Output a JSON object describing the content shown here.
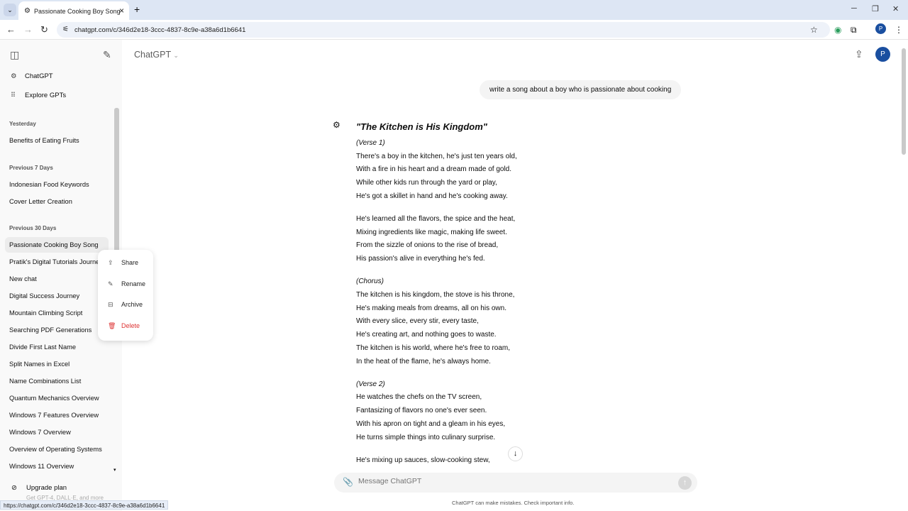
{
  "browser": {
    "tab_title": "Passionate Cooking Boy Song",
    "url": "chatgpt.com/c/346d2e18-3ccc-4837-8c9e-a38a6d1b6641",
    "profile": "P",
    "status_url": "https://chatgpt.com/c/346d2e18-3ccc-4837-8c9e-a38a6d1b6641"
  },
  "sidebar": {
    "top": [
      {
        "label": "ChatGPT",
        "icon": "openai-logo-icon"
      },
      {
        "label": "Explore GPTs",
        "icon": "grid-icon"
      }
    ],
    "groups": [
      {
        "heading": "Yesterday",
        "items": [
          "Benefits of Eating Fruits"
        ]
      },
      {
        "heading": "Previous 7 Days",
        "items": [
          "Indonesian Food Keywords",
          "Cover Letter Creation"
        ]
      },
      {
        "heading": "Previous 30 Days",
        "items": [
          "Passionate Cooking Boy Song",
          "Pratik's Digital Tutorials Journey",
          "New chat",
          "Digital Success Journey",
          "Mountain Climbing Script",
          "Searching PDF Generations",
          "Divide First Last Name",
          "Split Names in Excel",
          "Name Combinations List",
          "Quantum Mechanics Overview",
          "Windows 7 Features Overview",
          "Windows 7 Overview",
          "Overview of Operating Systems",
          "Windows 11 Overview"
        ]
      }
    ],
    "upgrade": {
      "label": "Upgrade plan",
      "sub": "Get GPT-4, DALL·E, and more"
    }
  },
  "context_menu": [
    "Share",
    "Rename",
    "Archive",
    "Delete"
  ],
  "header": {
    "model": "ChatGPT",
    "avatar": "P"
  },
  "chat": {
    "user_message": "write a song about a boy who is passionate about cooking",
    "title": "\"The Kitchen is His Kingdom\"",
    "stanzas": [
      {
        "label": "(Verse 1)",
        "lines": [
          "There's a boy in the kitchen, he's just ten years old,",
          "With a fire in his heart and a dream made of gold.",
          "While other kids run through the yard or play,",
          "He's got a skillet in hand and he's cooking away."
        ]
      },
      {
        "label": "",
        "lines": [
          "He's learned all the flavors, the spice and the heat,",
          "Mixing ingredients like magic, making life sweet.",
          "From the sizzle of onions to the rise of bread,",
          "His passion's alive in everything he's fed."
        ]
      },
      {
        "label": "(Chorus)",
        "lines": [
          "The kitchen is his kingdom, the stove is his throne,",
          "He's making meals from dreams, all on his own.",
          "With every slice, every stir, every taste,",
          "He's creating art, and nothing goes to waste.",
          "The kitchen is his world, where he's free to roam,",
          "In the heat of the flame, he's always home."
        ]
      },
      {
        "label": "(Verse 2)",
        "lines": [
          "He watches the chefs on the TV screen,",
          "Fantasizing of flavors no one's ever seen.",
          "With his apron on tight and a gleam in his eyes,",
          "He turns simple things into culinary surprise."
        ]
      },
      {
        "label": "",
        "lines": [
          "He's mixing up sauces, slow-cooking stew,"
        ]
      }
    ]
  },
  "composer": {
    "placeholder": "Message ChatGPT",
    "disclaimer": "ChatGPT can make mistakes. Check important info."
  }
}
